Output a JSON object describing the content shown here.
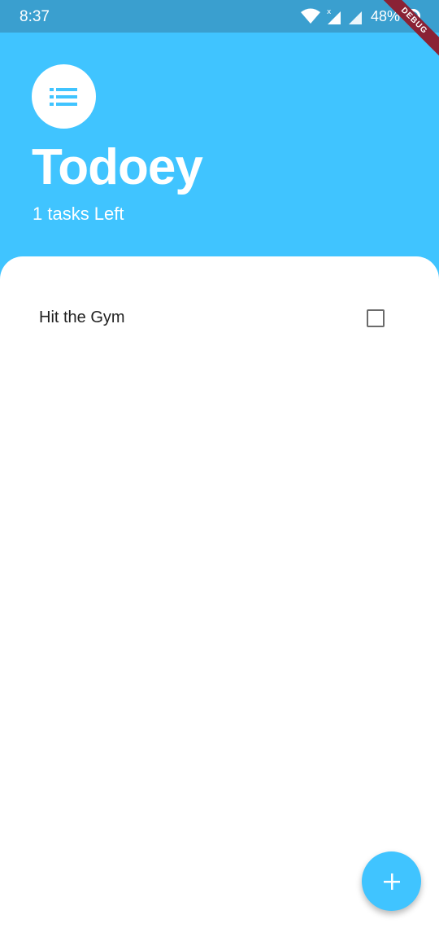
{
  "status_bar": {
    "time": "8:37",
    "battery": "48%",
    "icons": [
      "wifi-icon",
      "signal-icon",
      "signal-icon",
      "battery-icon"
    ]
  },
  "debug_banner": "DEBUG",
  "header": {
    "icon": "list-icon",
    "title": "Todoey",
    "subtitle": "1 tasks Left"
  },
  "tasks": [
    {
      "title": "Hit the Gym",
      "done": false
    }
  ],
  "fab": {
    "icon": "add-icon"
  },
  "colors": {
    "primary": "#40C4FF",
    "status_bar": "#3A9FCF",
    "debug_ribbon": "#8A2235",
    "text": "#212121"
  }
}
